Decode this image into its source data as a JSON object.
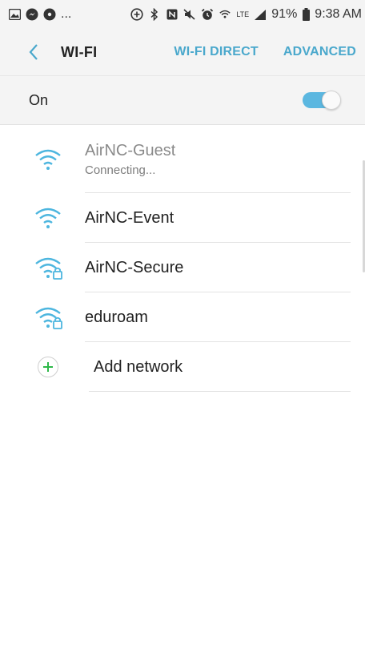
{
  "statusbar": {
    "left_more": "...",
    "battery": "91%",
    "time": "9:38 AM",
    "lte": "LTE"
  },
  "appbar": {
    "title": "WI-FI",
    "wifi_direct": "WI-FI DIRECT",
    "advanced": "ADVANCED"
  },
  "toggle": {
    "label": "On",
    "state": "on",
    "color": "#5bb7e0"
  },
  "networks": [
    {
      "name": "AirNC-Guest",
      "status": "Connecting...",
      "secured": false
    },
    {
      "name": "AirNC-Event",
      "secured": false
    },
    {
      "name": "AirNC-Secure",
      "secured": true
    },
    {
      "name": "eduroam",
      "secured": true
    }
  ],
  "add_network": {
    "label": "Add network"
  },
  "colors": {
    "accent": "#4aa8cc",
    "wifi": "#4db6df",
    "plus": "#2fb84a"
  }
}
